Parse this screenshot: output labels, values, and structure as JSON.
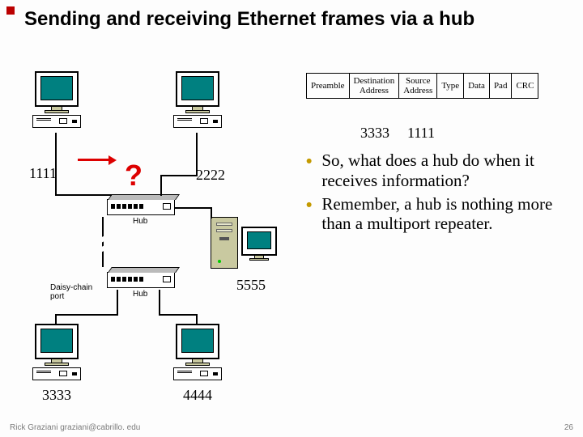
{
  "title": "Sending and receiving Ethernet frames via a hub",
  "frame_fields": [
    "Preamble",
    "Destination\nAddress",
    "Source\nAddress",
    "Type",
    "Data",
    "Pad",
    "CRC"
  ],
  "example": {
    "dest": "3333",
    "src": "1111"
  },
  "bullets": [
    "So, what does a hub do when it receives information?",
    "Remember, a hub is nothing more than a multiport repeater."
  ],
  "diagram": {
    "pc_labels": {
      "tl": "1111",
      "tr": "2222",
      "bl": "3333",
      "br": "4444",
      "server": "5555"
    },
    "hub_label": "Hub",
    "daisy_label": "Daisy-chain\nport",
    "question": "?"
  },
  "footer": "Rick Graziani  graziani@cabrillo. edu",
  "page": "26"
}
